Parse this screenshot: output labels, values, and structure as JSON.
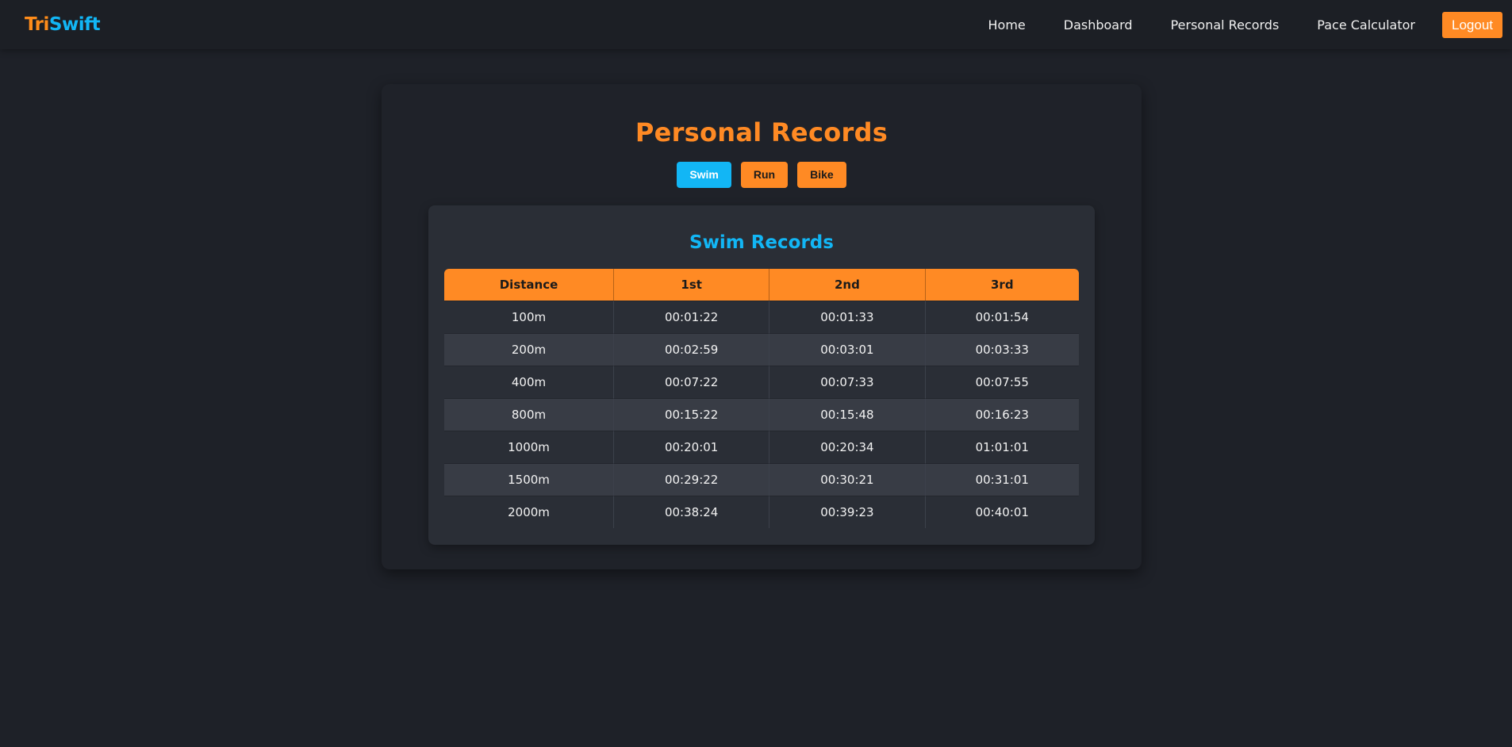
{
  "brand": {
    "part1": "Tri",
    "part2": "Swift"
  },
  "nav": {
    "links": [
      "Home",
      "Dashboard",
      "Personal Records",
      "Pace Calculator"
    ],
    "logout_label": "Logout"
  },
  "page": {
    "title": "Personal Records",
    "tabs": [
      {
        "label": "Swim",
        "active": true
      },
      {
        "label": "Run",
        "active": false
      },
      {
        "label": "Bike",
        "active": false
      }
    ]
  },
  "records": {
    "title": "Swim Records",
    "columns": [
      "Distance",
      "1st",
      "2nd",
      "3rd"
    ],
    "rows": [
      [
        "100m",
        "00:01:22",
        "00:01:33",
        "00:01:54"
      ],
      [
        "200m",
        "00:02:59",
        "00:03:01",
        "00:03:33"
      ],
      [
        "400m",
        "00:07:22",
        "00:07:33",
        "00:07:55"
      ],
      [
        "800m",
        "00:15:22",
        "00:15:48",
        "00:16:23"
      ],
      [
        "1000m",
        "00:20:01",
        "00:20:34",
        "01:01:01"
      ],
      [
        "1500m",
        "00:29:22",
        "00:30:21",
        "00:31:01"
      ],
      [
        "2000m",
        "00:38:24",
        "00:39:23",
        "00:40:01"
      ]
    ]
  },
  "colors": {
    "accent_orange": "#ff8a24",
    "accent_blue": "#12b6f5",
    "background": "#1e2128"
  }
}
